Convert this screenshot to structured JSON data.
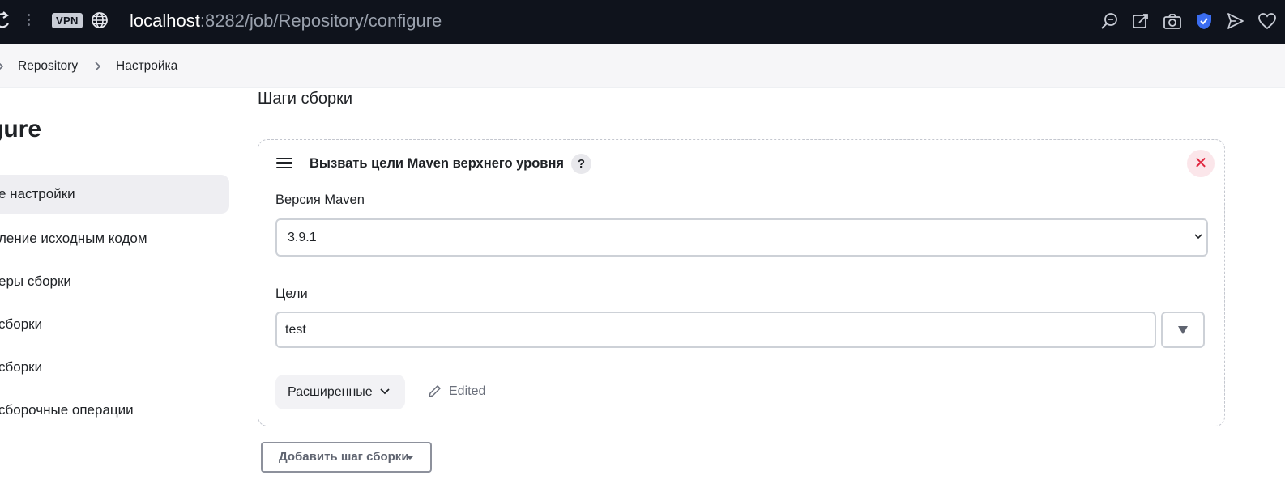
{
  "browser": {
    "vpn_label": "VPN",
    "url_host": "localhost",
    "url_path": ":8282/job/Repository/configure",
    "toolbar_icons": [
      "search-zoom-icon",
      "pin-icon",
      "camera-icon",
      "shield-icon",
      "send-icon",
      "heart-icon"
    ],
    "accent_color": "#3b6df0"
  },
  "breadcrumb": {
    "items": [
      "Repository",
      "Настройка"
    ]
  },
  "sidebar": {
    "heading": "gure",
    "items": [
      {
        "label": "е настройки",
        "active": true
      },
      {
        "label": "ление исходным кодом",
        "active": false
      },
      {
        "label": "еры сборки",
        "active": false
      },
      {
        "label": " сборки",
        "active": false
      },
      {
        "label": "сборки",
        "active": false
      },
      {
        "label": "сборочные операции",
        "active": false
      }
    ]
  },
  "main": {
    "section_title": "Шаги сборки",
    "step": {
      "title": "Вызвать цели Maven верхнего уровня",
      "help_label": "?",
      "close_label": "✕",
      "maven_version_label": "Версия Maven",
      "maven_version_value": "3.9.1",
      "goals_label": "Цели",
      "goals_value": "test",
      "advanced_label": "Расширенные",
      "edited_label": "Edited"
    },
    "add_step_label": "Добавить шаг сборки"
  }
}
